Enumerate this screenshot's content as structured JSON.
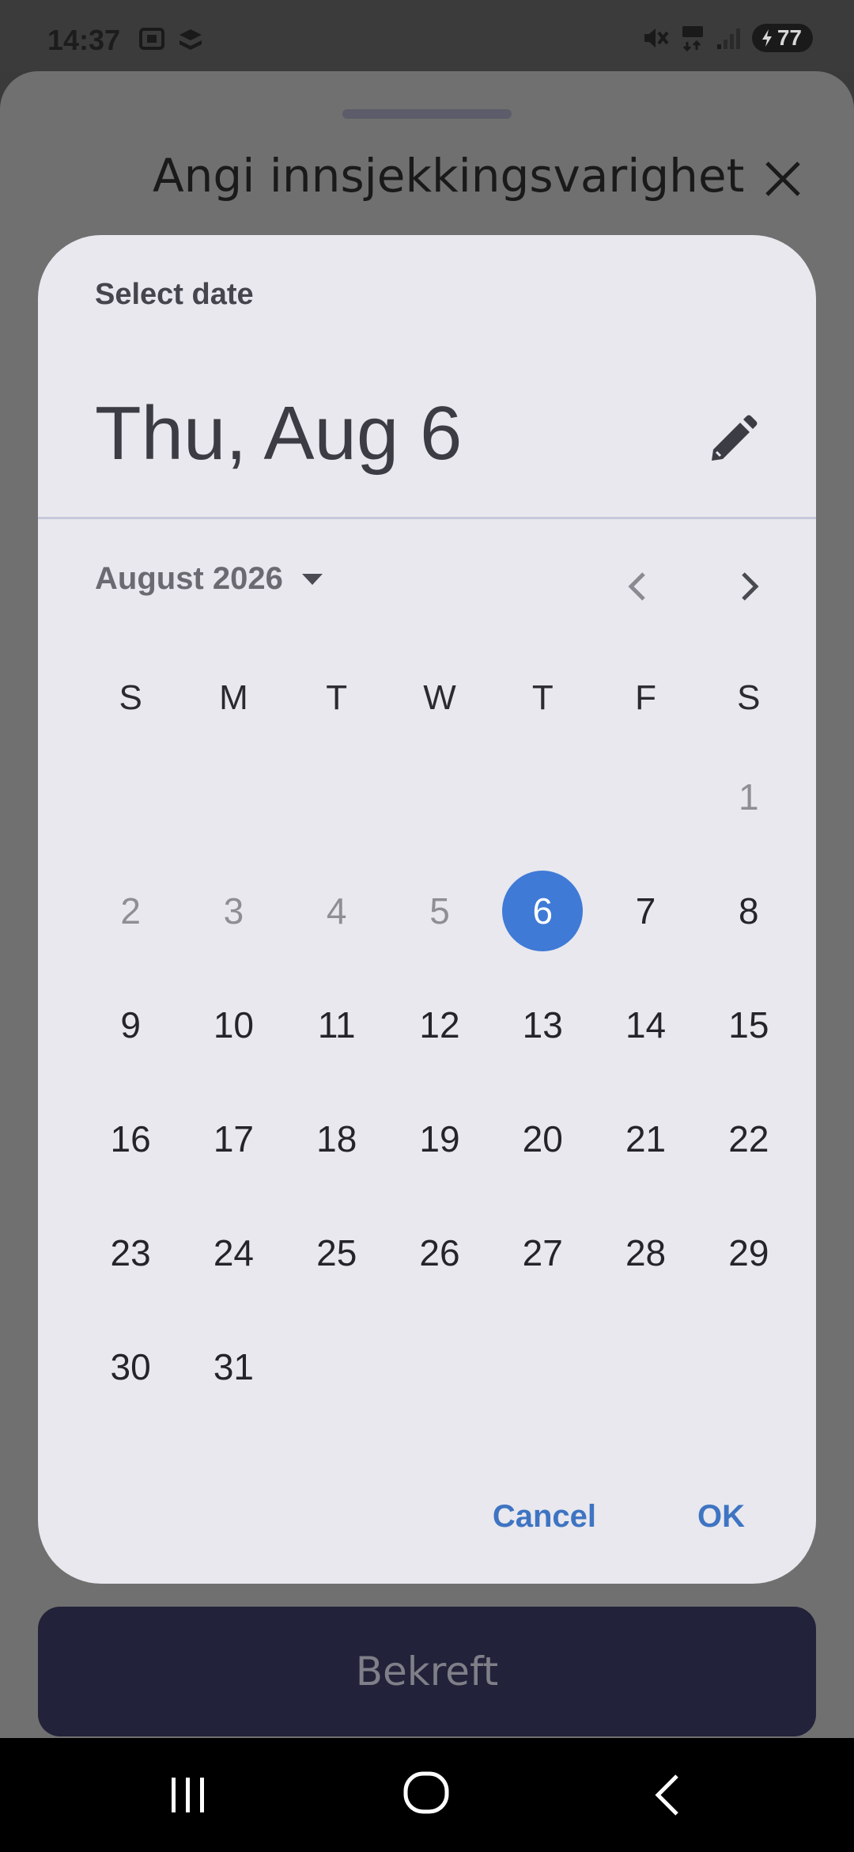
{
  "status_bar": {
    "time": "14:37",
    "left_icons": [
      "screenshot-icon",
      "app-icon"
    ],
    "right_icons": [
      "mute-icon",
      "5g-icon",
      "signal-icon"
    ],
    "battery": "77"
  },
  "sheet": {
    "title": "Angi innsjekkingsvarighet",
    "confirm_label": "Bekreft"
  },
  "date_dialog": {
    "label": "Select date",
    "selected_date": "Thu, Aug 6",
    "month_label": "August 2026",
    "weekdays": [
      "S",
      "M",
      "T",
      "W",
      "T",
      "F",
      "S"
    ],
    "weeks": [
      [
        "",
        "",
        "",
        "",
        "",
        "",
        "1"
      ],
      [
        "2",
        "3",
        "4",
        "5",
        "6",
        "7",
        "8"
      ],
      [
        "9",
        "10",
        "11",
        "12",
        "13",
        "14",
        "15"
      ],
      [
        "16",
        "17",
        "18",
        "19",
        "20",
        "21",
        "22"
      ],
      [
        "23",
        "24",
        "25",
        "26",
        "27",
        "28",
        "29"
      ],
      [
        "30",
        "31",
        "",
        "",
        "",
        "",
        ""
      ]
    ],
    "disabled_days": [
      "1",
      "2",
      "3",
      "4",
      "5"
    ],
    "selected_day": "6",
    "cancel_label": "Cancel",
    "ok_label": "OK"
  },
  "colors": {
    "accent": "#3f7ad6",
    "dialog_bg": "#e8e8ee",
    "confirm_bg": "#22223a"
  }
}
